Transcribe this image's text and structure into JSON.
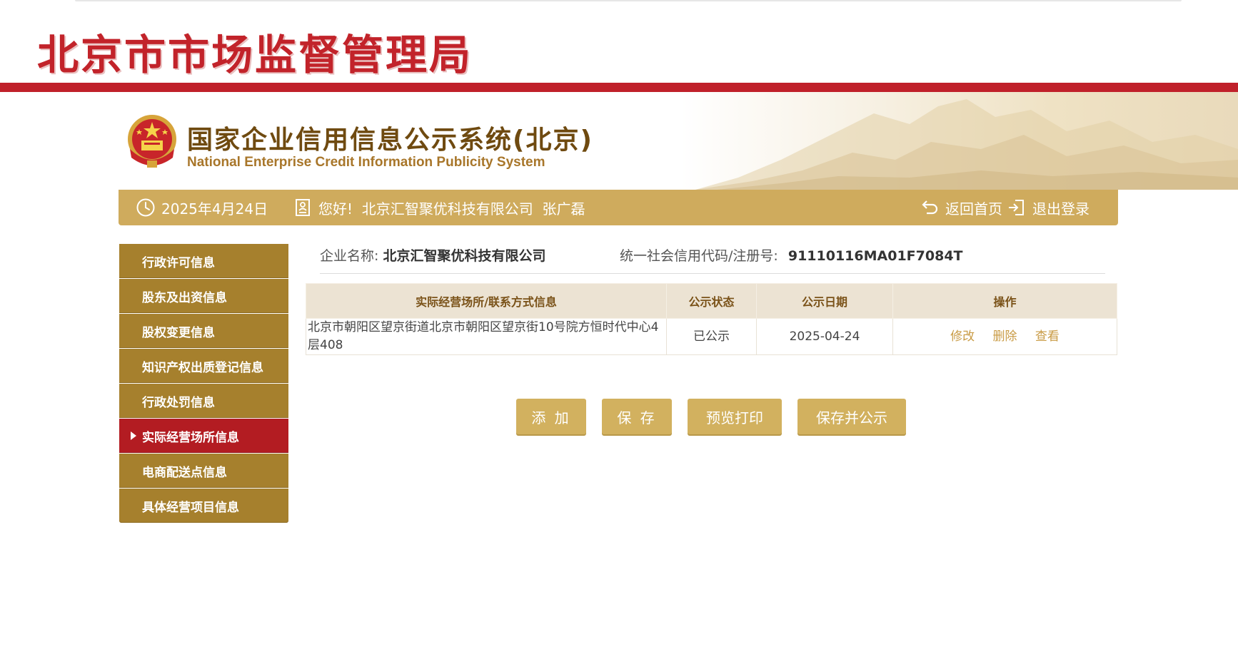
{
  "header": {
    "site_title": "北京市市场监督管理局",
    "system_title": "国家企业信用信息公示系统(北京)",
    "system_subtitle": "National Enterprise Credit Information Publicity System"
  },
  "info_bar": {
    "date": "2025年4月24日",
    "greeting": "您好!  北京汇智聚优科技有限公司  张广磊",
    "home_label": "返回首页",
    "logout_label": "退出登录"
  },
  "sidebar": {
    "items": [
      {
        "label": "行政许可信息"
      },
      {
        "label": "股东及出资信息"
      },
      {
        "label": "股权变更信息"
      },
      {
        "label": "知识产权出质登记信息"
      },
      {
        "label": "行政处罚信息"
      },
      {
        "label": "实际经营场所信息",
        "active": true
      },
      {
        "label": "电商配送点信息"
      },
      {
        "label": "具体经营项目信息"
      }
    ]
  },
  "company": {
    "name_label": "企业名称:",
    "name": "北京汇智聚优科技有限公司",
    "code_label": "统一社会信用代码/注册号:",
    "code": "91110116MA01F7084T"
  },
  "table": {
    "headers": [
      "实际经营场所/联系方式信息",
      "公示状态",
      "公示日期",
      "操作"
    ],
    "rows": [
      {
        "address": "北京市朝阳区望京街道北京市朝阳区望京街10号院方恒时代中心4层408",
        "status": "已公示",
        "date": "2025-04-24",
        "actions": [
          "修改",
          "删除",
          "查看"
        ]
      }
    ]
  },
  "buttons": {
    "add": "添 加",
    "save": "保 存",
    "preview": "预览打印",
    "save_publish": "保存并公示"
  },
  "colors": {
    "brand_red": "#c0202a",
    "gold_bar": "#cfab5d",
    "sidebar_gold": "#a6802d",
    "sidebar_active": "#b31c22",
    "button_gold": "#d2b15f"
  }
}
